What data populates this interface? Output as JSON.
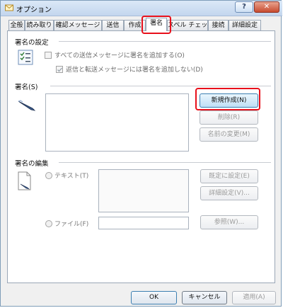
{
  "window": {
    "title": "オプション",
    "help_button": "?",
    "close_button": "✕"
  },
  "tabs": [
    {
      "label": "全般"
    },
    {
      "label": "読み取り"
    },
    {
      "label": "確認メッセージ"
    },
    {
      "label": "送信"
    },
    {
      "label": "作成"
    },
    {
      "label": "署名"
    },
    {
      "label": "スペル チェック"
    },
    {
      "label": "接続"
    },
    {
      "label": "詳細設定"
    }
  ],
  "active_tab": "署名",
  "settings": {
    "title": "署名の設定",
    "add_to_all": "すべての送信メッセージに署名を追加する(O)",
    "no_reply_forward": "返信と転送メッセージには署名を追加しない(D)"
  },
  "signatures": {
    "title": "署名(S)",
    "new_button": "新規作成(N)",
    "delete_button": "削除(R)",
    "rename_button": "名前の変更(M)"
  },
  "edit": {
    "title": "署名の編集",
    "text_radio": "テキスト(T)",
    "file_radio": "ファイル(F)",
    "set_default_button": "既定に設定(E)",
    "advanced_button": "詳細設定(V)...",
    "browse_button": "参照(W)..."
  },
  "footer": {
    "ok": "OK",
    "cancel": "キャンセル",
    "apply": "適用(A)"
  },
  "colors": {
    "highlight_red": "#e8101b",
    "primary_button": "#bfdff5"
  }
}
